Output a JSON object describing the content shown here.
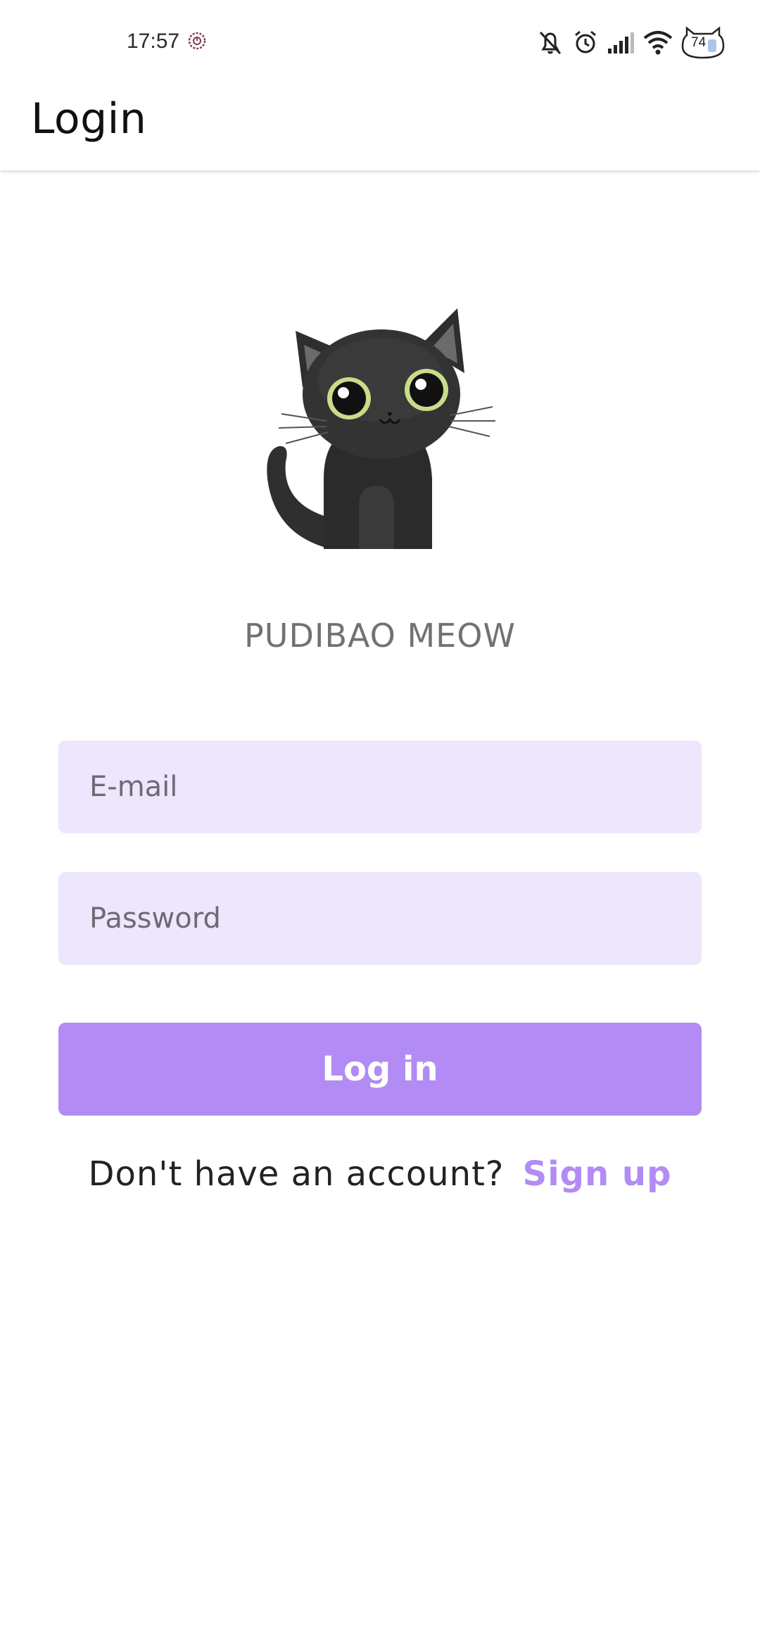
{
  "status_bar": {
    "time": "17:57",
    "battery_level": "74",
    "icons": [
      "clock-app-icon",
      "mute-icon",
      "alarm-icon",
      "signal-icon",
      "wifi-icon",
      "battery-icon"
    ]
  },
  "app_bar": {
    "title": "Login"
  },
  "logo": {
    "icon": "black-cat-icon",
    "brand_name": "PUDIBAO MEOW"
  },
  "form": {
    "email_placeholder": "E-mail",
    "email_value": "",
    "password_placeholder": "Password",
    "password_value": "",
    "login_label": "Log in"
  },
  "signup": {
    "prompt": "Don't have an account?",
    "link_label": "Sign up"
  },
  "colors": {
    "accent": "#b28bf4",
    "field_background": "#ede6fc",
    "brand_text": "#727272"
  }
}
